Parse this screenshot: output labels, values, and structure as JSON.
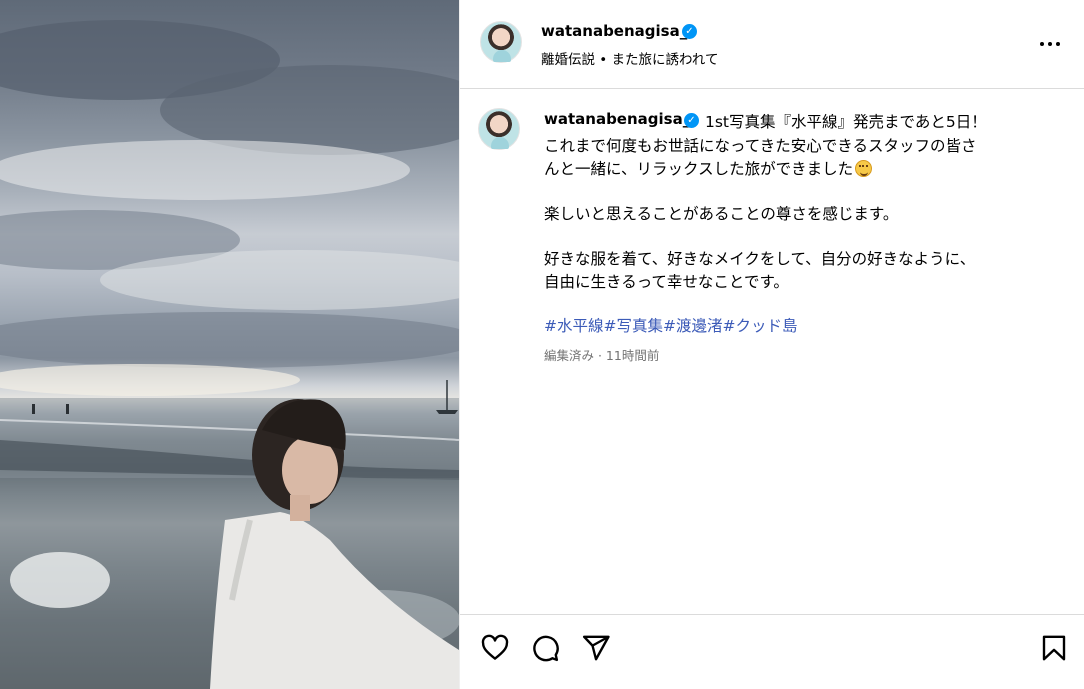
{
  "post": {
    "username": "watanabenagisa_",
    "subtitle": "離婚伝説 • また旅に誘われて"
  },
  "caption": {
    "username": "watanabenagisa_",
    "lines": [
      "1st写真集『水平線』発売まであと5日！",
      "これまで何度もお世話になってきた安心できるスタッフの皆さ",
      "んと一緒に、リラックスした旅ができました",
      "楽しいと思えることがあることの尊さを感じます。",
      "好きな服を着て、好きなメイクをして、自分の好きなように、",
      "自由に生きるって幸せなことです。"
    ],
    "hashtags": [
      "#水平線",
      "#写真集",
      "#渡邊渚",
      "#クッド島"
    ],
    "edited": "編集済み · 11時間前"
  },
  "colors": {
    "verified": "#0095f6",
    "hashtag": "#3c5bb8"
  },
  "icons": [
    "verified-badge-icon",
    "more-options-icon",
    "heart-icon",
    "comment-icon",
    "share-icon",
    "bookmark-icon"
  ]
}
